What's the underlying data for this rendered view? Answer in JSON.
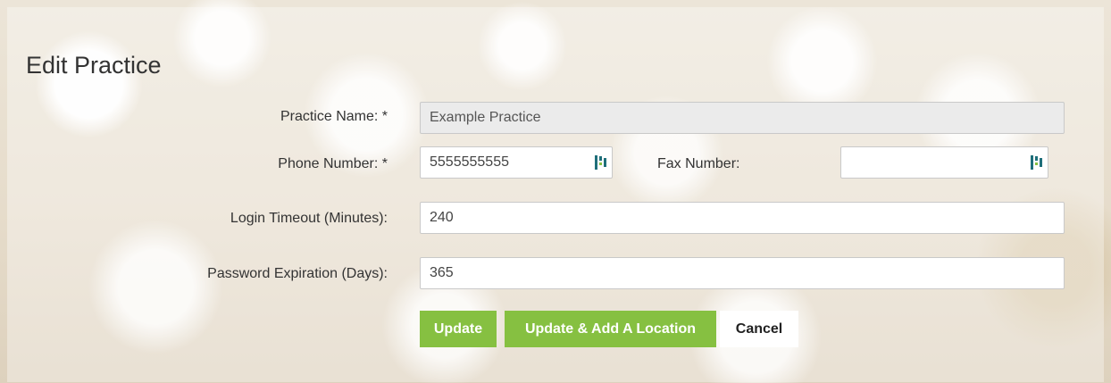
{
  "title": "Edit Practice",
  "form": {
    "practice_name": {
      "label": "Practice Name: *",
      "value": "Example Practice"
    },
    "phone_number": {
      "label": "Phone Number: *",
      "value": "5555555555"
    },
    "fax_number": {
      "label": "Fax Number:",
      "value": ""
    },
    "login_timeout": {
      "label": "Login Timeout (Minutes):",
      "value": "240"
    },
    "password_expiration": {
      "label": "Password Expiration (Days):",
      "value": "365"
    }
  },
  "buttons": {
    "update": "Update",
    "update_add_location": "Update & Add A Location",
    "cancel": "Cancel"
  },
  "icons": {
    "phone_field_icon": "phone-widget-icon",
    "fax_field_icon": "phone-widget-icon"
  },
  "colors": {
    "accent_green": "#86c041",
    "icon_teal": "#1f6f7a"
  }
}
